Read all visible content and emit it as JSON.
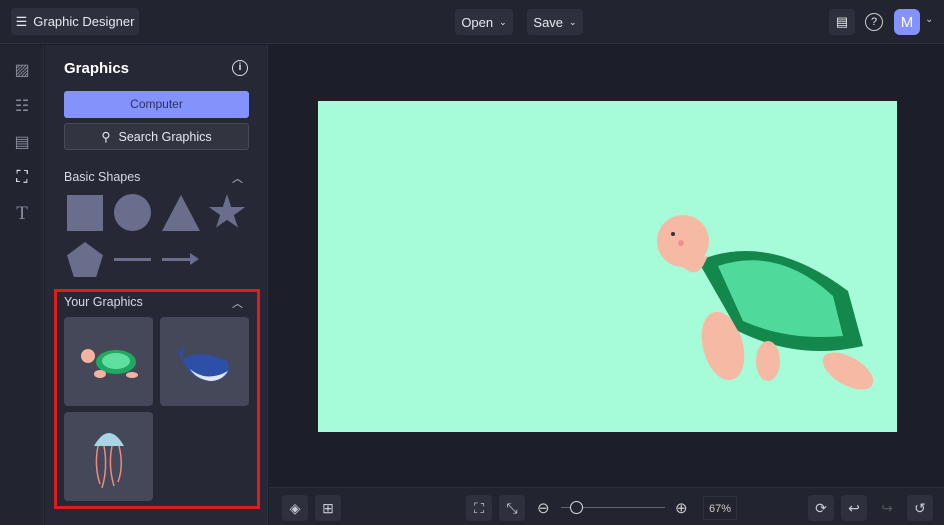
{
  "header": {
    "menu_icon": "hamburger-icon",
    "app_title": "Graphic Designer",
    "open_label": "Open",
    "save_label": "Save",
    "avatar_initial": "M"
  },
  "rail": [
    "image-icon",
    "sliders-icon",
    "layout-icon",
    "shapes-icon",
    "text-icon"
  ],
  "panel": {
    "title": "Graphics",
    "computer_label": "Computer",
    "search_label": "Search Graphics",
    "basic_shapes": "Basic Shapes",
    "your_graphics": "Your Graphics",
    "graphics": [
      "turtle",
      "whale",
      "jellyfish"
    ]
  },
  "canvas": {
    "background": "#a6fcd8"
  },
  "footer": {
    "zoom": "67%",
    "zoom_fraction": 0.67
  },
  "colors": {
    "accent": "#8493fb",
    "highlight": "#e01b1b"
  }
}
